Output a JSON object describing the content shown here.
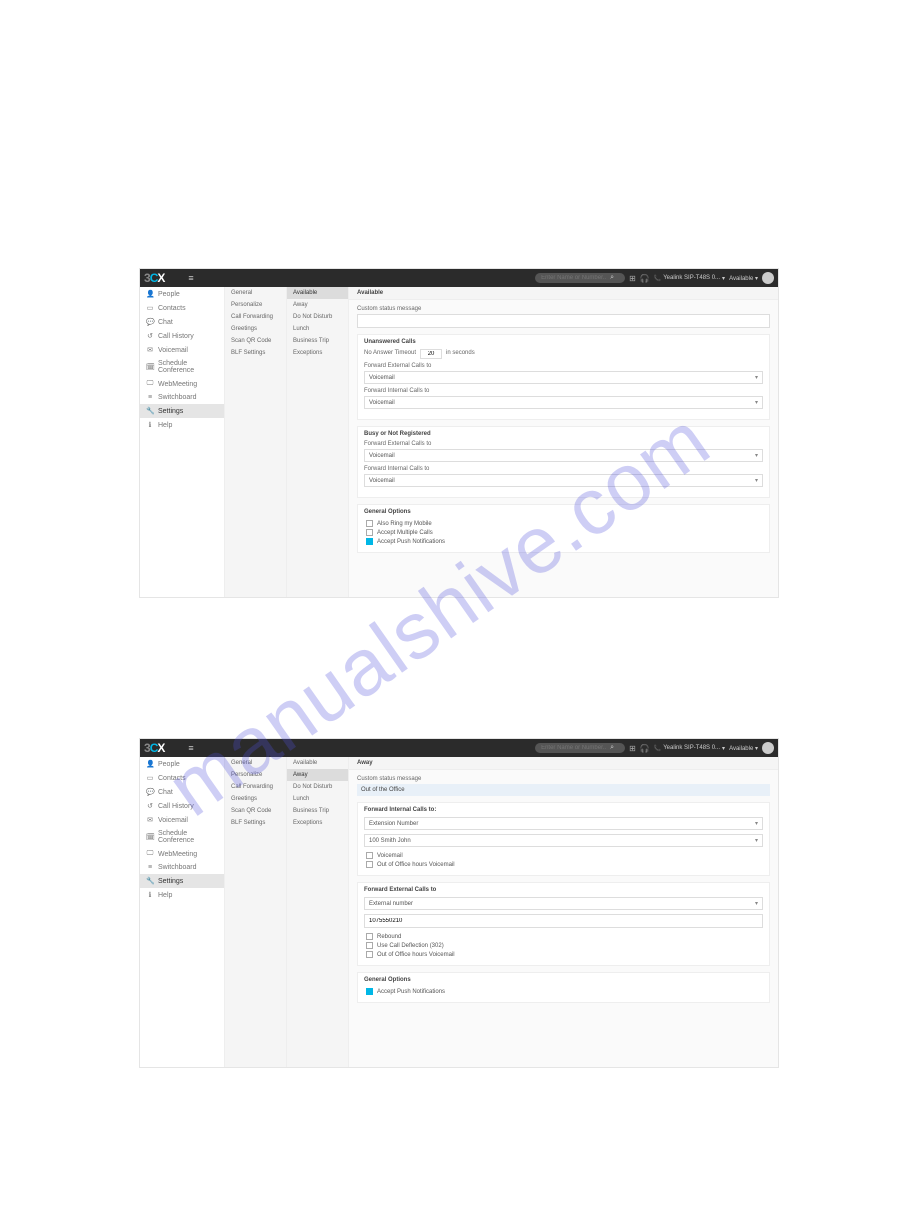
{
  "topbar": {
    "search_placeholder": "Enter Name or Number...",
    "device": "Yealink SIP-T48S 0...",
    "status": "Available"
  },
  "nav": [
    {
      "icon": "👤",
      "label": "People"
    },
    {
      "icon": "▭",
      "label": "Contacts"
    },
    {
      "icon": "💬",
      "label": "Chat"
    },
    {
      "icon": "↺",
      "label": "Call History"
    },
    {
      "icon": "✉",
      "label": "Voicemail"
    },
    {
      "icon": "🗓",
      "label": "Schedule Conference"
    },
    {
      "icon": "🖵",
      "label": "WebMeeting"
    },
    {
      "icon": "≡",
      "label": "Switchboard"
    },
    {
      "icon": "🔧",
      "label": "Settings"
    },
    {
      "icon": "ℹ",
      "label": "Help"
    }
  ],
  "settings_col": [
    "General",
    "Personalize",
    "Call Forwarding",
    "Greetings",
    "Scan QR Code",
    "BLF Settings"
  ],
  "status_col": [
    "Available",
    "Away",
    "Do Not Disturb",
    "Lunch",
    "Business Trip",
    "Exceptions"
  ],
  "shot1": {
    "header": "Available",
    "custom_label": "Custom status message",
    "card_unanswered": {
      "title": "Unanswered Calls",
      "no_answer_label": "No Answer Timeout",
      "no_answer_value": "20",
      "no_answer_unit": "in seconds",
      "fwd_ext_label": "Forward External Calls to",
      "fwd_ext_value": "Voicemail",
      "fwd_int_label": "Forward Internal Calls to",
      "fwd_int_value": "Voicemail"
    },
    "card_busy": {
      "title": "Busy or Not Registered",
      "fwd_ext_label": "Forward External Calls to",
      "fwd_ext_value": "Voicemail",
      "fwd_int_label": "Forward Internal Calls to",
      "fwd_int_value": "Voicemail"
    },
    "card_general": {
      "title": "General Options",
      "opt1": "Also Ring my Mobile",
      "opt2": "Accept Multiple Calls",
      "opt3": "Accept Push Notifications"
    }
  },
  "shot2": {
    "header": "Away",
    "custom_label": "Custom status message",
    "out_of_office": "Out of the Office",
    "card_int": {
      "title": "Forward Internal Calls to:",
      "sel": "Extension Number",
      "ext": "100 Smith John",
      "opt_vm": "Voicemail",
      "opt_ooh": "Out of Office hours Voicemail"
    },
    "card_ext": {
      "title": "Forward External Calls to",
      "sel": "External number",
      "num": "1075550210",
      "opt_rebound": "Rebound",
      "opt_302": "Use Call Deflection (302)",
      "opt_ooh": "Out of Office hours Voicemail"
    },
    "card_general": {
      "title": "General Options",
      "opt1": "Accept Push Notifications"
    }
  }
}
